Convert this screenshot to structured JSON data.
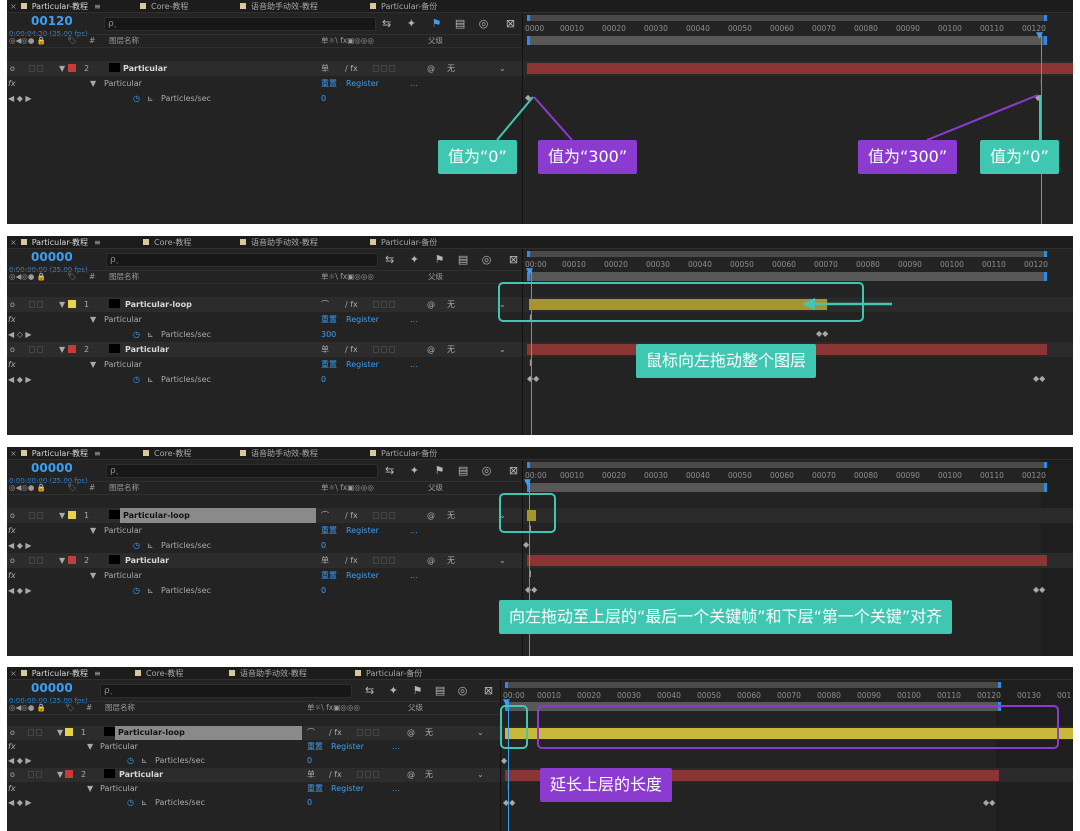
{
  "tabs": {
    "close": "×",
    "menu": "≡",
    "items": [
      "Particular-教程",
      "Core-教程",
      "语音助手动效-教程",
      "Particular-备份"
    ]
  },
  "search": {
    "placeholder": "ρ˯"
  },
  "headers": {
    "icons": "◎◀◎● 🔒",
    "tag": "🏷",
    "hash": "#",
    "layer_name": "图层名称",
    "switches": "单☼\\ fx▣◎◎◎",
    "parent": "父级"
  },
  "ruler_ticks": [
    "0000",
    "00010",
    "00020",
    "00030",
    "00040",
    "00050",
    "00060",
    "00070",
    "00080",
    "00090",
    "00100",
    "00110",
    "00120"
  ],
  "ruler_ticks_p2": [
    "00:00",
    "00010",
    "00020",
    "00030",
    "00040",
    "00050",
    "00060",
    "00070",
    "00080",
    "00090",
    "00100",
    "00110",
    "00120"
  ],
  "ruler_ticks_p4": [
    "00:00",
    "00010",
    "00020",
    "00030",
    "00040",
    "00050",
    "00060",
    "00070",
    "00080",
    "00090",
    "00100",
    "00110",
    "00120",
    "00130",
    "001"
  ],
  "common": {
    "effect": "Particular",
    "reset": "重置",
    "register": "Register",
    "dots": "...",
    "param": "Particles/sec",
    "none": "无",
    "fx": "fx",
    "switch_a": "单",
    "switch_b": "∕ fx",
    "switch_c": "⌒",
    "spiral": "@",
    "caret": "⌄",
    "tri": "▼",
    "eye": "o",
    "stop": "◷",
    "graph": "⊾",
    "kf_nav": "◀ ◆ ▶",
    "kf_nav_empty": "◀ ◇ ▶",
    "keyframe": "◆",
    "keyframe_pair": "◆◆",
    "ibeam": "I",
    "head": "▼"
  },
  "panel1": {
    "timecode": "00120",
    "timecode_sub": "0:00:04:20 (25.00 fps)",
    "layer": {
      "num": "2",
      "name": "Particular",
      "color": "#c43c3c"
    },
    "value": "0",
    "callouts": [
      "值为“0”",
      "值为“300”",
      "值为“300”",
      "值为“0”"
    ]
  },
  "panel2": {
    "timecode": "00000",
    "timecode_sub": "0:00:00:00 (25.00 fps)",
    "layer1": {
      "num": "1",
      "name": "Particular-loop",
      "color": "#e6d34a",
      "value": "300"
    },
    "layer2": {
      "num": "2",
      "name": "Particular",
      "color": "#c43c3c",
      "value": "0"
    },
    "callout": "鼠标向左拖动整个图层"
  },
  "panel3": {
    "timecode": "00000",
    "timecode_sub": "0:00:00:00 (25.00 fps)",
    "layer1": {
      "num": "1",
      "name": "Particular-loop",
      "value": "0"
    },
    "layer2": {
      "num": "2",
      "name": "Particular",
      "value": "0"
    },
    "callout": "向左拖动至上层的“最后一个关键帧”和下层“第一个关键”对齐"
  },
  "panel4": {
    "timecode": "00000",
    "timecode_sub": "0:00:00:00 (25.00 fps)",
    "layer1": {
      "num": "1",
      "name": "Particular-loop",
      "value": "0"
    },
    "layer2": {
      "num": "2",
      "name": "Particular",
      "value": "0"
    },
    "callout": "延长上层的长度"
  },
  "colors": {
    "teal": "#3fc7b2",
    "purple": "#8c3bd1",
    "accent": "#3d9ef0",
    "red_layer": "#8b3434",
    "yellow_layer": "#a6952f"
  }
}
